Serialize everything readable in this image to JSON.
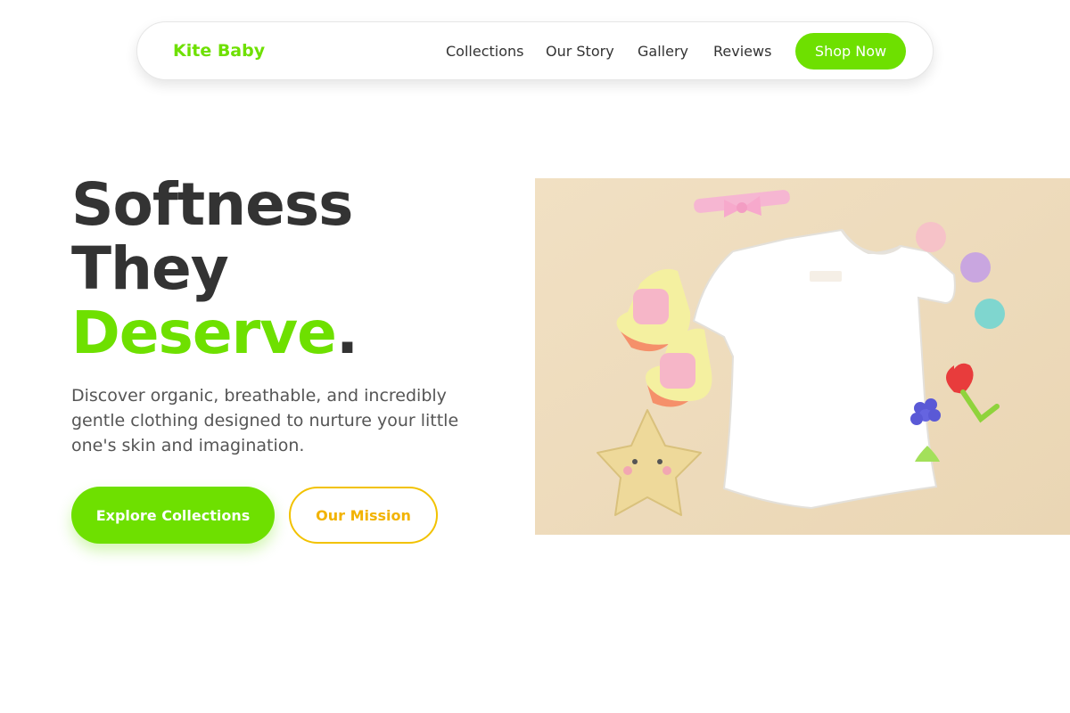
{
  "nav": {
    "brand": "Kite Baby",
    "links": [
      "Collections",
      "Our Story",
      "Gallery",
      "Reviews"
    ],
    "cta": "Shop Now"
  },
  "hero": {
    "title_line1": "Softness",
    "title_line2": "They",
    "title_line3": "Deserve",
    "title_punct": ".",
    "description": "Discover organic, breathable, and incredibly gentle clothing designed to nurture your little one's skin and imagination.",
    "primary_button": "Explore Collections",
    "secondary_button": "Our Mission"
  },
  "colors": {
    "accent": "#6ee000",
    "secondary": "#f2b300",
    "text": "#333333",
    "image_background": "#efdcbc"
  }
}
